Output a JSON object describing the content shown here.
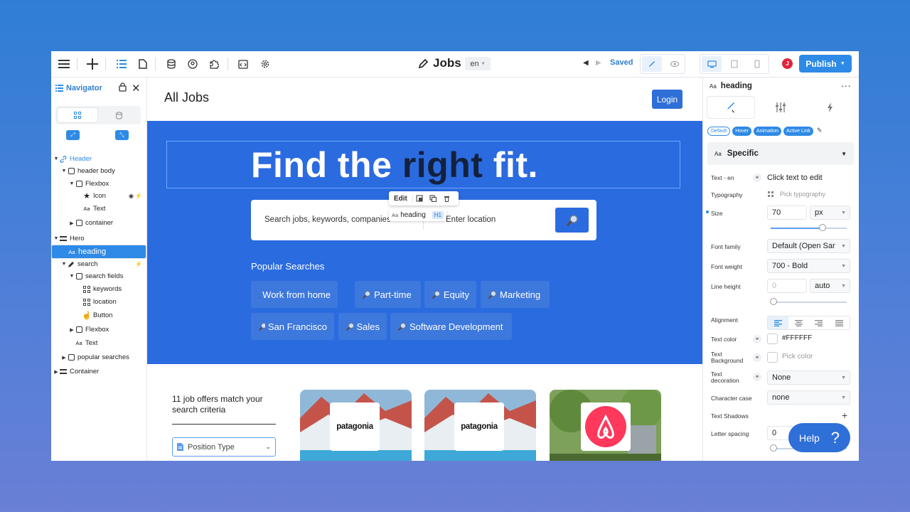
{
  "app": {
    "page_title": "Jobs",
    "language": "en",
    "saved": "Saved",
    "publish": "Publish",
    "avatar": "J"
  },
  "navigator": {
    "title": "Navigator",
    "tree": [
      {
        "label": "Header",
        "depth": 0,
        "icon": "link-icon",
        "expanded": true
      },
      {
        "label": "header body",
        "depth": 1,
        "icon": "box-icon",
        "expanded": true
      },
      {
        "label": "Flexbox",
        "depth": 2,
        "icon": "box-icon",
        "expanded": true
      },
      {
        "label": "Icon",
        "depth": 3,
        "icon": "star-icon"
      },
      {
        "label": "Text",
        "depth": 3,
        "icon": "text-icon"
      },
      {
        "label": "container",
        "depth": 2,
        "icon": "box-icon",
        "collapsed": true
      },
      {
        "label": "Hero",
        "depth": 0,
        "icon": "section-icon",
        "expanded": true
      },
      {
        "label": "heading",
        "depth": 1,
        "icon": "text-icon",
        "selected": true
      },
      {
        "label": "search",
        "depth": 1,
        "icon": "pen-icon",
        "expanded": true
      },
      {
        "label": "search fields",
        "depth": 2,
        "icon": "box-icon",
        "expanded": true
      },
      {
        "label": "keywords",
        "depth": 3,
        "icon": "grid-icon"
      },
      {
        "label": "location",
        "depth": 3,
        "icon": "grid-icon"
      },
      {
        "label": "Button",
        "depth": 3,
        "icon": "pointer-icon"
      },
      {
        "label": "Flexbox",
        "depth": 2,
        "icon": "box-icon",
        "collapsed": true
      },
      {
        "label": "Text",
        "depth": 2,
        "icon": "text-icon"
      },
      {
        "label": "popular searches",
        "depth": 1,
        "icon": "box-icon",
        "collapsed": true
      },
      {
        "label": "Container",
        "depth": 0,
        "icon": "section-icon",
        "collapsed": true
      }
    ]
  },
  "site": {
    "title": "All Jobs",
    "login": "Login",
    "heading_part1": "Find the ",
    "heading_part2": "right",
    "heading_part3": " fit.",
    "edit": "Edit",
    "selected_badge": "heading",
    "selected_badge_tag": "H1",
    "search_placeholder": "Search jobs, keywords, companies",
    "location_placeholder": "Enter location",
    "popular_title": "Popular Searches",
    "chips": [
      "Work from home",
      "Part-time",
      "Equity",
      "Marketing",
      "San Francisco",
      "Sales",
      "Software Development"
    ],
    "match_text": "11 job offers match your search criteria",
    "position_type": "Position Type",
    "cards": [
      "patagonia",
      "patagonia",
      "airbnb"
    ]
  },
  "panel": {
    "element": "heading",
    "states": [
      "Default",
      "Hover",
      "Animation",
      "Active Link"
    ],
    "section": "Specific",
    "fields": {
      "text_label": "Text - en",
      "text_value": "Click text to edit",
      "typography_label": "Typography",
      "typography_value": "Pick typography",
      "size_label": "Size",
      "size_value": "70",
      "size_unit": "px",
      "font_family_label": "Font family",
      "font_family_value": "Default (Open Sar",
      "font_weight_label": "Font weight",
      "font_weight_value": "700 - Bold",
      "line_height_label": "Line height",
      "line_height_value": "0",
      "line_height_unit": "auto",
      "alignment_label": "Alignment",
      "text_color_label": "Text color",
      "text_color_value": "#FFFFFF",
      "text_bg_label_1": "Text",
      "text_bg_label_2": "Background",
      "text_bg_value": "Pick color",
      "text_deco_label_1": "Text",
      "text_deco_label_2": "decoration",
      "text_deco_value": "None",
      "char_case_label": "Character case",
      "char_case_value": "none",
      "shadows_label": "Text Shadows",
      "letter_spacing_label": "Letter spacing",
      "letter_spacing_value": "0"
    }
  },
  "help": {
    "label": "Help",
    "q": "?"
  },
  "colors": {
    "accent": "#2e8ae6",
    "hero": "#2b6be0",
    "chip": "#3d78dd",
    "dark_word": "#14213d"
  }
}
